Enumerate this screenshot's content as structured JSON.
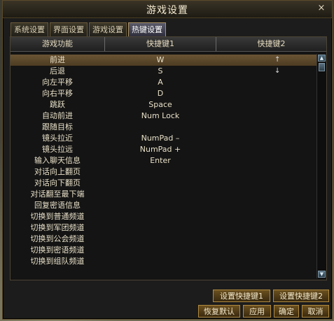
{
  "window": {
    "title": "游戏设置",
    "close_glyph": "×"
  },
  "tabs": [
    {
      "label": "系统设置",
      "active": false
    },
    {
      "label": "界面设置",
      "active": false
    },
    {
      "label": "游戏设置",
      "active": false
    },
    {
      "label": "热键设置",
      "active": true
    }
  ],
  "table": {
    "headers": [
      "游戏功能",
      "快捷键1",
      "快捷键2"
    ],
    "rows": [
      {
        "function": "前进",
        "key1": "W",
        "key2": "",
        "selected": true
      },
      {
        "function": "后退",
        "key1": "S",
        "key2": ""
      },
      {
        "function": "向左平移",
        "key1": "A",
        "key2": ""
      },
      {
        "function": "向右平移",
        "key1": "D",
        "key2": ""
      },
      {
        "function": "跳跃",
        "key1": "Space",
        "key2": ""
      },
      {
        "function": "自动前进",
        "key1": "Num Lock",
        "key2": ""
      },
      {
        "function": "跟随目标",
        "key1": "",
        "key2": ""
      },
      {
        "function": "镜头拉近",
        "key1": "NumPad –",
        "key2": ""
      },
      {
        "function": "镜头拉远",
        "key1": "NumPad +",
        "key2": ""
      },
      {
        "function": "输入聊天信息",
        "key1": "Enter",
        "key2": ""
      },
      {
        "function": "对话向上翻页",
        "key1": "",
        "key2": ""
      },
      {
        "function": "对话向下翻页",
        "key1": "",
        "key2": ""
      },
      {
        "function": "对话翻至最下端",
        "key1": "",
        "key2": ""
      },
      {
        "function": "回复密语信息",
        "key1": "",
        "key2": ""
      },
      {
        "function": "切换到普通频道",
        "key1": "",
        "key2": ""
      },
      {
        "function": "切换到军团频道",
        "key1": "",
        "key2": ""
      },
      {
        "function": "切换到公会频道",
        "key1": "",
        "key2": ""
      },
      {
        "function": "切换到密语频道",
        "key1": "",
        "key2": ""
      },
      {
        "function": "切换到组队频道",
        "key1": "",
        "key2": ""
      }
    ],
    "arrow_marks": [
      "↑",
      "↓"
    ]
  },
  "scrollbar": {
    "up_glyph": "▲",
    "down_glyph": "▼"
  },
  "buttons": {
    "set_key1": "设置快捷键1",
    "set_key2": "设置快捷键2",
    "restore_default": "恢复默认",
    "apply": "应用",
    "ok": "确定",
    "cancel": "取消"
  }
}
